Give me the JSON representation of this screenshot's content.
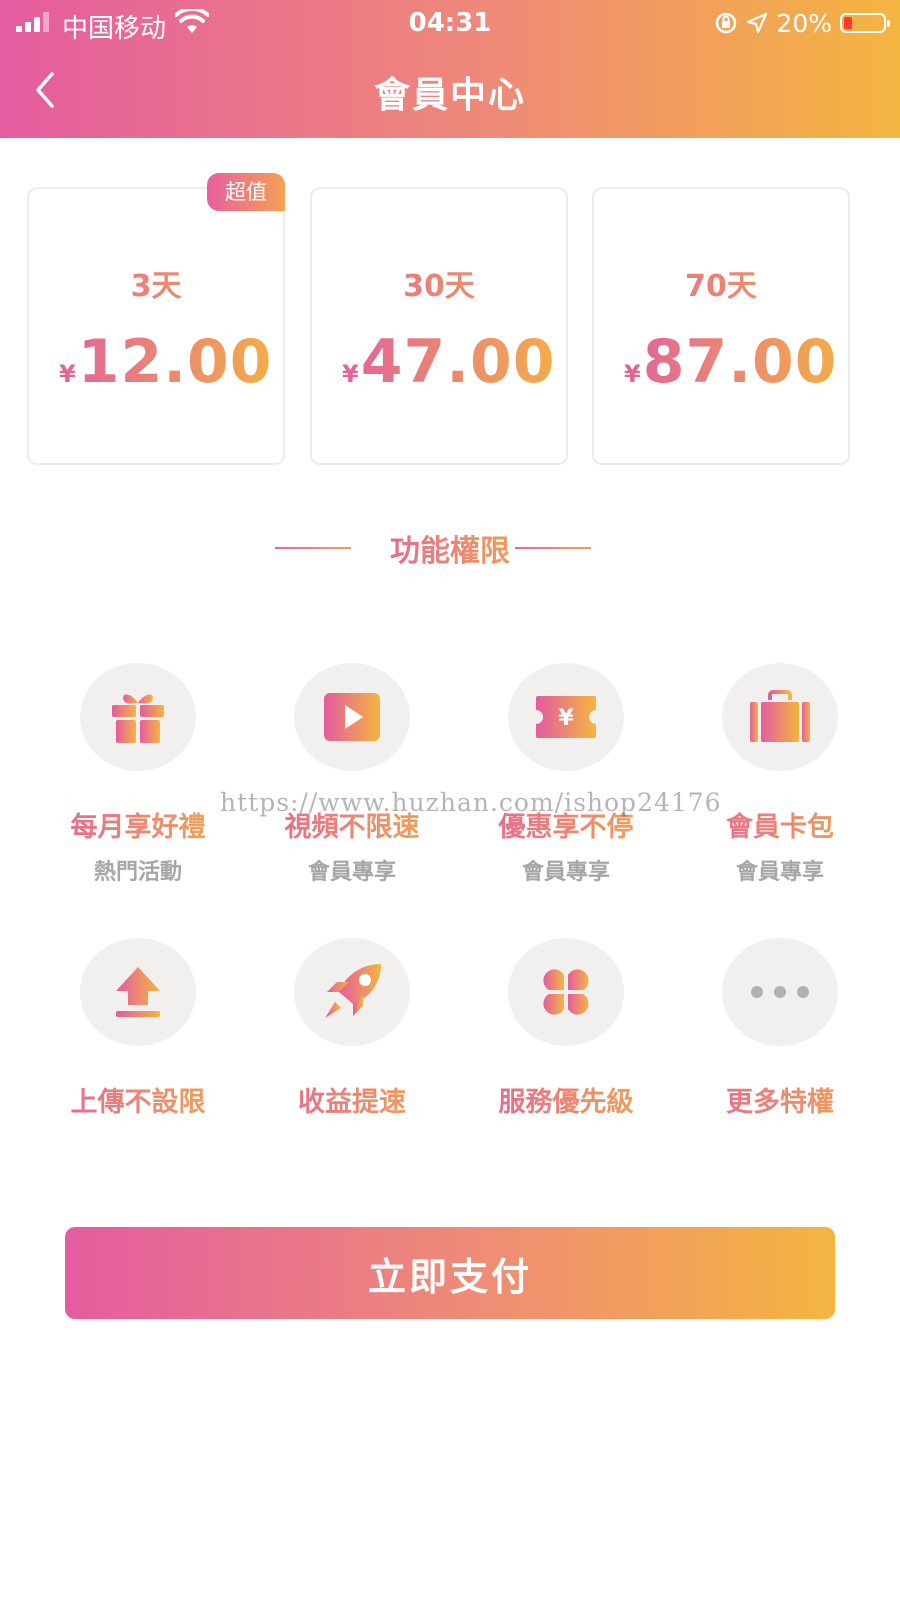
{
  "status_bar": {
    "carrier": "中国移动",
    "time": "04:31",
    "battery_percent": "20%",
    "battery_level": 0.2
  },
  "nav": {
    "title": "會員中心",
    "back_icon": "chevron-left-icon"
  },
  "plans": [
    {
      "days": "3天",
      "currency": "¥",
      "price": "12.00",
      "badge": "超值"
    },
    {
      "days": "30天",
      "currency": "¥",
      "price": "47.00"
    },
    {
      "days": "70天",
      "currency": "¥",
      "price": "87.00"
    }
  ],
  "section_title": "功能權限",
  "features": [
    {
      "icon": "gift-icon",
      "label": "每月享好禮",
      "sub": "熱門活動"
    },
    {
      "icon": "play-icon",
      "label": "視頻不限速",
      "sub": "會員專享"
    },
    {
      "icon": "coupon-icon",
      "label": "優惠享不停",
      "sub": "會員專享"
    },
    {
      "icon": "briefcase-icon",
      "label": "會員卡包",
      "sub": "會員專享"
    },
    {
      "icon": "upload-icon",
      "label": "上傳不設限"
    },
    {
      "icon": "rocket-icon",
      "label": "收益提速"
    },
    {
      "icon": "clover-icon",
      "label": "服務優先級"
    },
    {
      "icon": "more-icon",
      "label": "更多特權"
    }
  ],
  "watermark": "https://www.huzhan.com/ishop24176",
  "pay_button": "立即支付",
  "colors": {
    "gradient_start": "#e45c9f",
    "gradient_end": "#f4b540",
    "icon_bg": "#f2f0ee",
    "sub_text": "#a6a6a6"
  }
}
